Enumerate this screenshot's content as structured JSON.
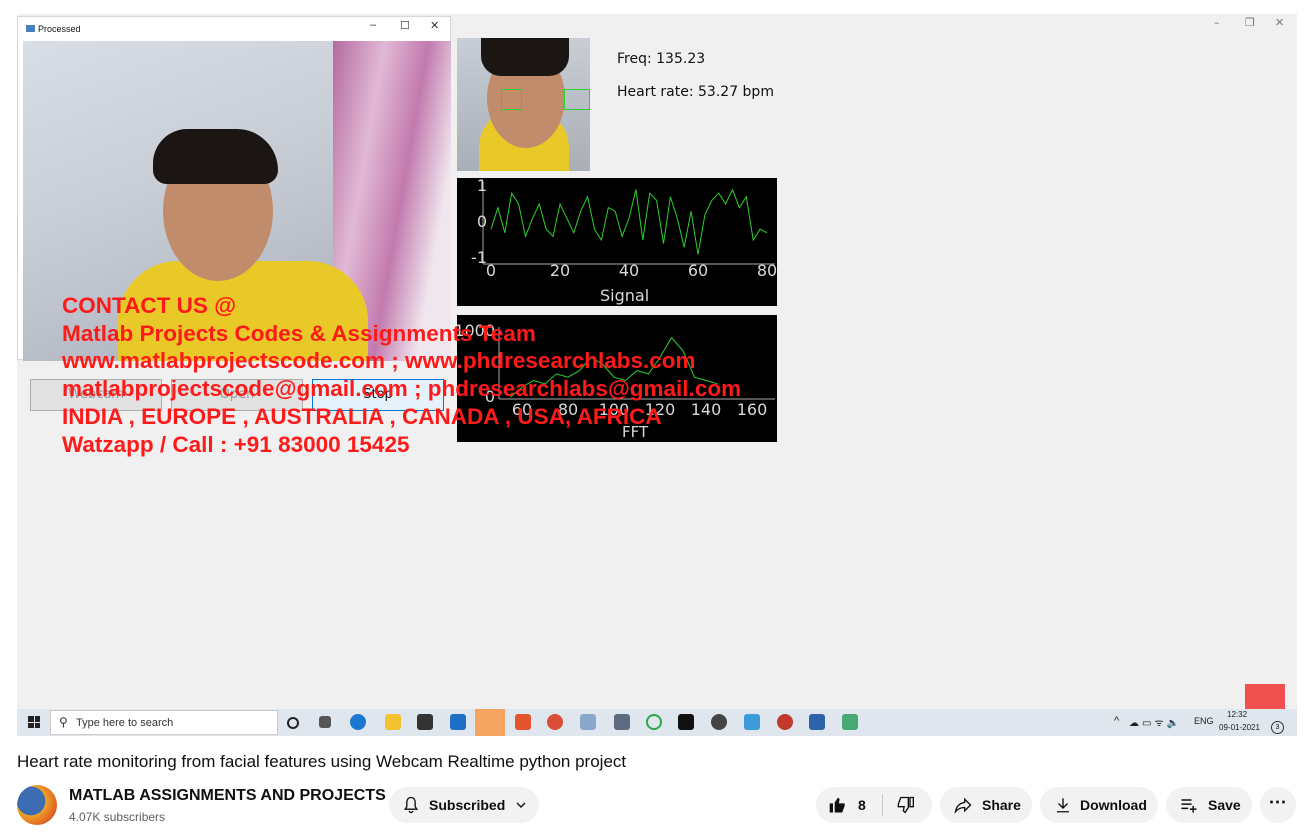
{
  "video": {
    "processed_window": {
      "title": "Processed"
    },
    "freq_label": "Freq: 135.23",
    "heart_rate_label": "Heart rate: 53.27 bpm",
    "buttons": {
      "webcam": "Webcam",
      "open": "Open",
      "stop": "Stop"
    },
    "overlay_lines": [
      "CONTACT US @",
      "Matlab Projects Codes & Assignments Team",
      "www.matlabprojectscode.com ; www.phdresearchlabs.com",
      "matlabprojectscode@gmail.com ; phdresearchlabs@gmail.com",
      "INDIA , EUROPE , AUSTRALIA , CANADA , USA, AFRICA",
      "Watzapp / Call : +91 83000 15425"
    ],
    "signal_plot": {
      "xlabel": "Signal",
      "xticks": [
        "0",
        "20",
        "40",
        "60",
        "80"
      ],
      "yticks": [
        "1",
        "0",
        "-1"
      ],
      "color": "#2bd12b"
    },
    "fft_plot": {
      "xlabel": "FFT",
      "xticks": [
        "60",
        "80",
        "100",
        "120",
        "140",
        "160"
      ],
      "yticks": [
        "1000",
        "0"
      ],
      "color": "#2bd12b"
    },
    "taskbar": {
      "search_placeholder": "Type here to search",
      "language": "ENG",
      "time": "12:32",
      "date": "09-01-2021",
      "notification_count": "3"
    }
  },
  "chart_data": [
    {
      "type": "line",
      "xlabel": "Signal",
      "x": [
        0,
        2,
        4,
        6,
        8,
        10,
        12,
        14,
        16,
        18,
        20,
        22,
        24,
        26,
        28,
        30,
        32,
        34,
        36,
        38,
        40,
        42,
        44,
        46,
        48,
        50,
        52,
        54,
        56,
        58,
        60,
        62,
        64,
        66,
        68,
        70,
        72,
        74,
        76,
        78,
        80
      ],
      "y": [
        -0.2,
        0.4,
        -0.3,
        0.8,
        0.5,
        -0.4,
        0.1,
        0.5,
        -0.2,
        -0.4,
        0.5,
        0.1,
        -0.3,
        0.3,
        0.7,
        -0.2,
        -0.5,
        0.4,
        0.3,
        -0.4,
        0.1,
        0.9,
        -0.5,
        0.8,
        0.6,
        -0.6,
        0.7,
        0.1,
        -0.7,
        0.3,
        -0.9,
        0.2,
        0.6,
        0.8,
        0.5,
        0.9,
        0.4,
        0.7,
        -0.5,
        -0.2,
        -0.3
      ],
      "xlim": [
        0,
        80
      ],
      "ylim": [
        -1,
        1
      ],
      "grid": false
    },
    {
      "type": "line",
      "xlabel": "FFT",
      "x": [
        55,
        60,
        65,
        70,
        75,
        80,
        85,
        90,
        95,
        100,
        105,
        110,
        115,
        120,
        125,
        130,
        135,
        140,
        145
      ],
      "y": [
        0,
        150,
        250,
        200,
        350,
        300,
        400,
        600,
        500,
        300,
        250,
        400,
        350,
        600,
        900,
        700,
        300,
        250,
        200
      ],
      "xlim": [
        50,
        170
      ],
      "ylim": [
        0,
        1000
      ],
      "grid": false
    }
  ],
  "below": {
    "title": "Heart rate monitoring from facial features using Webcam Realtime python project",
    "channel_name": "MATLAB ASSIGNMENTS AND PROJECTS",
    "subscribers": "4.07K subscribers",
    "subscribe_label": "Subscribed",
    "like_count": "8",
    "share_label": "Share",
    "download_label": "Download",
    "save_label": "Save"
  }
}
